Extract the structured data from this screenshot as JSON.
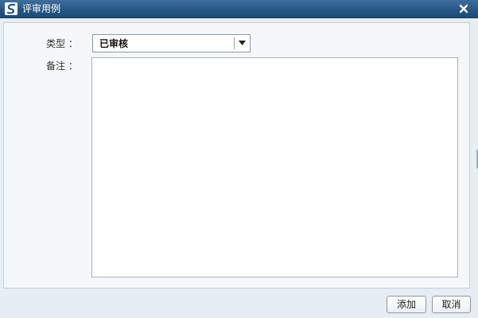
{
  "window": {
    "title": "评审用例",
    "app_icon": "app-logo-icon",
    "close_icon": "close-icon",
    "close_glyph": "✕"
  },
  "form": {
    "type_label": "类型 ：",
    "type_value": "已审核",
    "remark_label": "备注 ：",
    "remark_value": ""
  },
  "buttons": {
    "add_label": "添加",
    "cancel_label": "取消"
  },
  "colors": {
    "titlebar": "#255683",
    "panel_bg": "#f6f7f8",
    "dialog_bg": "#e6edf3"
  }
}
